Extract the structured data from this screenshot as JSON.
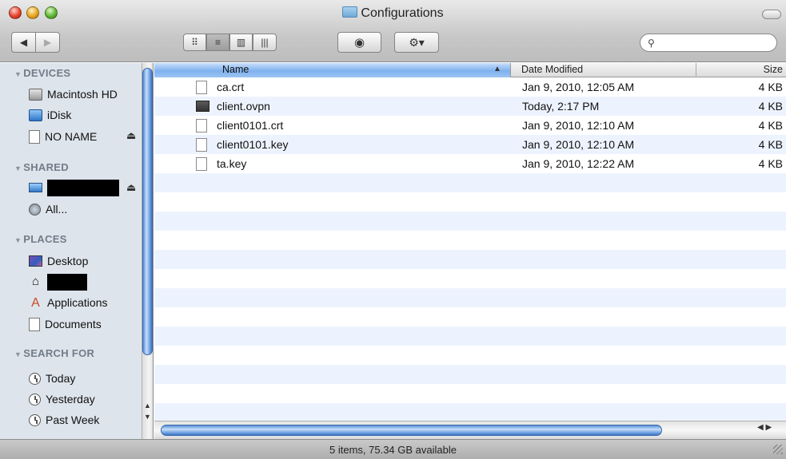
{
  "window": {
    "title": "Configurations",
    "status": "5 items, 75.34 GB available"
  },
  "toolbar": {
    "back_icon": "◀",
    "forward_icon": "▶",
    "views": [
      "icon-view-icon",
      "list-view-icon",
      "column-view-icon",
      "coverflow-view-icon"
    ],
    "view_glyphs": [
      "⠿",
      "≡",
      "▥",
      "|||"
    ],
    "selected_view": "list",
    "quicklook_glyph": "◉",
    "action_glyph": "⚙▾",
    "search_value": "",
    "search_glyph": "⚲"
  },
  "sidebar": {
    "sections": [
      {
        "title": "DEVICES"
      },
      {
        "title": "SHARED"
      },
      {
        "title": "PLACES"
      },
      {
        "title": "SEARCH FOR"
      }
    ],
    "devices": [
      {
        "label": "Macintosh HD",
        "icon": "hard-drive-icon"
      },
      {
        "label": "iDisk",
        "icon": "idisk-icon"
      },
      {
        "label": "NO NAME",
        "icon": "volume-icon",
        "eject": "⏏"
      }
    ],
    "shared": [
      {
        "label": "",
        "icon": "monitor-icon",
        "redacted": true,
        "eject": "⏏"
      },
      {
        "label": "All...",
        "icon": "globe-icon"
      }
    ],
    "places": [
      {
        "label": "Desktop",
        "icon": "desktop-icon"
      },
      {
        "label": "",
        "icon": "home-icon",
        "redacted": true
      },
      {
        "label": "Applications",
        "icon": "applications-icon"
      },
      {
        "label": "Documents",
        "icon": "documents-icon"
      }
    ],
    "search_for": [
      {
        "label": "Today",
        "icon": "clock-icon"
      },
      {
        "label": "Yesterday",
        "icon": "clock-icon"
      },
      {
        "label": "Past Week",
        "icon": "clock-icon"
      }
    ]
  },
  "list": {
    "columns": {
      "name": "Name",
      "date": "Date Modified",
      "size": "Size"
    },
    "sort_arrow": "▲",
    "rows": [
      {
        "name": "ca.crt",
        "date": "Jan 9, 2010, 12:05 AM",
        "size": "4 KB",
        "icon": "document-icon"
      },
      {
        "name": "client.ovpn",
        "date": "Today, 2:17 PM",
        "size": "4 KB",
        "icon": "tunnelblick-icon"
      },
      {
        "name": "client0101.crt",
        "date": "Jan 9, 2010, 12:10 AM",
        "size": "4 KB",
        "icon": "document-icon"
      },
      {
        "name": "client0101.key",
        "date": "Jan 9, 2010, 12:10 AM",
        "size": "4 KB",
        "icon": "document-icon"
      },
      {
        "name": "ta.key",
        "date": "Jan 9, 2010, 12:22 AM",
        "size": "4 KB",
        "icon": "document-icon"
      }
    ]
  },
  "colors": {
    "sidebar_bg": "#dde4eb",
    "alt_row": "#edf3fe",
    "scroll_blue": "#5a8fd8"
  }
}
